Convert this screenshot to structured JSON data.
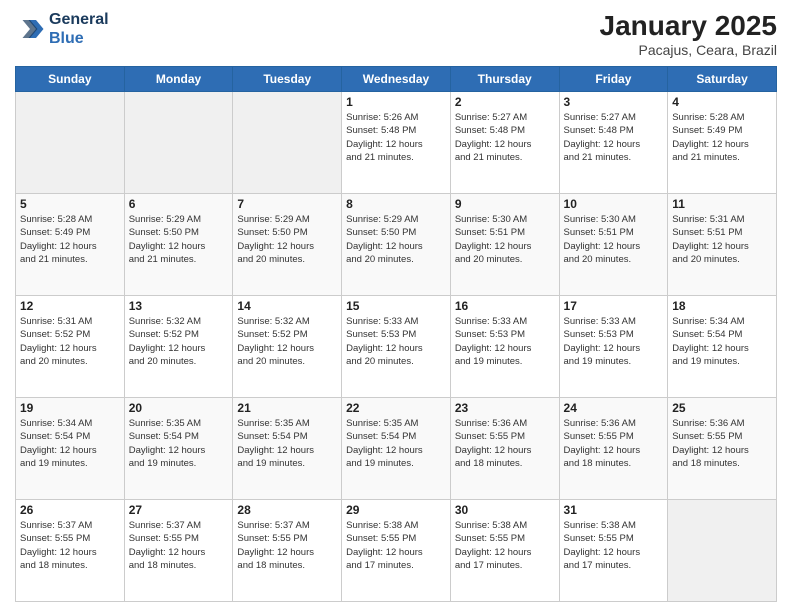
{
  "header": {
    "logo_line1": "General",
    "logo_line2": "Blue",
    "month_title": "January 2025",
    "location": "Pacajus, Ceara, Brazil"
  },
  "days_of_week": [
    "Sunday",
    "Monday",
    "Tuesday",
    "Wednesday",
    "Thursday",
    "Friday",
    "Saturday"
  ],
  "weeks": [
    {
      "days": [
        {
          "num": "",
          "info": ""
        },
        {
          "num": "",
          "info": ""
        },
        {
          "num": "",
          "info": ""
        },
        {
          "num": "1",
          "info": "Sunrise: 5:26 AM\nSunset: 5:48 PM\nDaylight: 12 hours\nand 21 minutes."
        },
        {
          "num": "2",
          "info": "Sunrise: 5:27 AM\nSunset: 5:48 PM\nDaylight: 12 hours\nand 21 minutes."
        },
        {
          "num": "3",
          "info": "Sunrise: 5:27 AM\nSunset: 5:48 PM\nDaylight: 12 hours\nand 21 minutes."
        },
        {
          "num": "4",
          "info": "Sunrise: 5:28 AM\nSunset: 5:49 PM\nDaylight: 12 hours\nand 21 minutes."
        }
      ]
    },
    {
      "days": [
        {
          "num": "5",
          "info": "Sunrise: 5:28 AM\nSunset: 5:49 PM\nDaylight: 12 hours\nand 21 minutes."
        },
        {
          "num": "6",
          "info": "Sunrise: 5:29 AM\nSunset: 5:50 PM\nDaylight: 12 hours\nand 21 minutes."
        },
        {
          "num": "7",
          "info": "Sunrise: 5:29 AM\nSunset: 5:50 PM\nDaylight: 12 hours\nand 20 minutes."
        },
        {
          "num": "8",
          "info": "Sunrise: 5:29 AM\nSunset: 5:50 PM\nDaylight: 12 hours\nand 20 minutes."
        },
        {
          "num": "9",
          "info": "Sunrise: 5:30 AM\nSunset: 5:51 PM\nDaylight: 12 hours\nand 20 minutes."
        },
        {
          "num": "10",
          "info": "Sunrise: 5:30 AM\nSunset: 5:51 PM\nDaylight: 12 hours\nand 20 minutes."
        },
        {
          "num": "11",
          "info": "Sunrise: 5:31 AM\nSunset: 5:51 PM\nDaylight: 12 hours\nand 20 minutes."
        }
      ]
    },
    {
      "days": [
        {
          "num": "12",
          "info": "Sunrise: 5:31 AM\nSunset: 5:52 PM\nDaylight: 12 hours\nand 20 minutes."
        },
        {
          "num": "13",
          "info": "Sunrise: 5:32 AM\nSunset: 5:52 PM\nDaylight: 12 hours\nand 20 minutes."
        },
        {
          "num": "14",
          "info": "Sunrise: 5:32 AM\nSunset: 5:52 PM\nDaylight: 12 hours\nand 20 minutes."
        },
        {
          "num": "15",
          "info": "Sunrise: 5:33 AM\nSunset: 5:53 PM\nDaylight: 12 hours\nand 20 minutes."
        },
        {
          "num": "16",
          "info": "Sunrise: 5:33 AM\nSunset: 5:53 PM\nDaylight: 12 hours\nand 19 minutes."
        },
        {
          "num": "17",
          "info": "Sunrise: 5:33 AM\nSunset: 5:53 PM\nDaylight: 12 hours\nand 19 minutes."
        },
        {
          "num": "18",
          "info": "Sunrise: 5:34 AM\nSunset: 5:54 PM\nDaylight: 12 hours\nand 19 minutes."
        }
      ]
    },
    {
      "days": [
        {
          "num": "19",
          "info": "Sunrise: 5:34 AM\nSunset: 5:54 PM\nDaylight: 12 hours\nand 19 minutes."
        },
        {
          "num": "20",
          "info": "Sunrise: 5:35 AM\nSunset: 5:54 PM\nDaylight: 12 hours\nand 19 minutes."
        },
        {
          "num": "21",
          "info": "Sunrise: 5:35 AM\nSunset: 5:54 PM\nDaylight: 12 hours\nand 19 minutes."
        },
        {
          "num": "22",
          "info": "Sunrise: 5:35 AM\nSunset: 5:54 PM\nDaylight: 12 hours\nand 19 minutes."
        },
        {
          "num": "23",
          "info": "Sunrise: 5:36 AM\nSunset: 5:55 PM\nDaylight: 12 hours\nand 18 minutes."
        },
        {
          "num": "24",
          "info": "Sunrise: 5:36 AM\nSunset: 5:55 PM\nDaylight: 12 hours\nand 18 minutes."
        },
        {
          "num": "25",
          "info": "Sunrise: 5:36 AM\nSunset: 5:55 PM\nDaylight: 12 hours\nand 18 minutes."
        }
      ]
    },
    {
      "days": [
        {
          "num": "26",
          "info": "Sunrise: 5:37 AM\nSunset: 5:55 PM\nDaylight: 12 hours\nand 18 minutes."
        },
        {
          "num": "27",
          "info": "Sunrise: 5:37 AM\nSunset: 5:55 PM\nDaylight: 12 hours\nand 18 minutes."
        },
        {
          "num": "28",
          "info": "Sunrise: 5:37 AM\nSunset: 5:55 PM\nDaylight: 12 hours\nand 18 minutes."
        },
        {
          "num": "29",
          "info": "Sunrise: 5:38 AM\nSunset: 5:55 PM\nDaylight: 12 hours\nand 17 minutes."
        },
        {
          "num": "30",
          "info": "Sunrise: 5:38 AM\nSunset: 5:55 PM\nDaylight: 12 hours\nand 17 minutes."
        },
        {
          "num": "31",
          "info": "Sunrise: 5:38 AM\nSunset: 5:55 PM\nDaylight: 12 hours\nand 17 minutes."
        },
        {
          "num": "",
          "info": ""
        }
      ]
    }
  ]
}
